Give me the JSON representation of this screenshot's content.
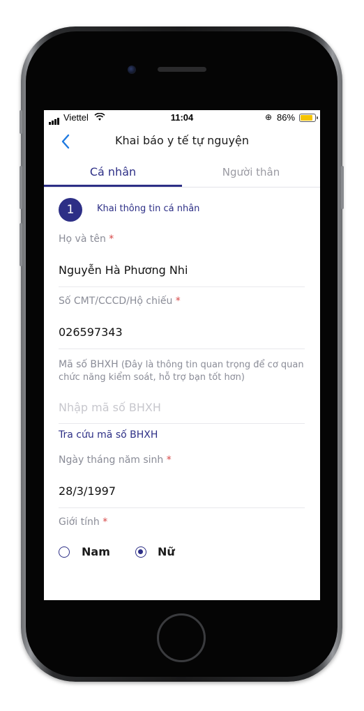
{
  "status_bar": {
    "carrier": "Viettel",
    "time": "11:04",
    "battery_percent": "86%",
    "battery_color": "#f5c400"
  },
  "nav": {
    "back_icon": "chevron-left-icon",
    "title": "Khai báo y tế tự nguyện"
  },
  "tabs": [
    {
      "label": "Cá nhân",
      "active": true
    },
    {
      "label": "Người thân",
      "active": false
    }
  ],
  "step": {
    "number": "1",
    "title": "Khai thông tin cá nhân"
  },
  "form": {
    "full_name": {
      "label": "Họ và tên",
      "required_mark": "*",
      "value": "Nguyễn Hà Phương Nhi"
    },
    "id_number": {
      "label": "Số CMT/CCCD/Hộ chiếu",
      "required_mark": "*",
      "value": "026597343"
    },
    "insurance": {
      "label": "Mã số BHXH",
      "note": "(Đây là thông tin quan trọng để cơ quan chức năng kiểm soát, hỗ trợ bạn tốt hơn)",
      "placeholder": "Nhập mã số BHXH",
      "value": "",
      "lookup_link": "Tra cứu mã số BHXH"
    },
    "birth_date": {
      "label": "Ngày tháng năm sinh",
      "required_mark": "*",
      "value": "28/3/1997"
    },
    "gender": {
      "label": "Giới tính",
      "required_mark": "*",
      "options": [
        {
          "label": "Nam",
          "selected": false
        },
        {
          "label": "Nữ",
          "selected": true
        }
      ]
    }
  },
  "colors": {
    "accent": "#2d2f86",
    "required": "#d64545",
    "label": "#8a8c97",
    "back_arrow": "#1f7ae0"
  }
}
